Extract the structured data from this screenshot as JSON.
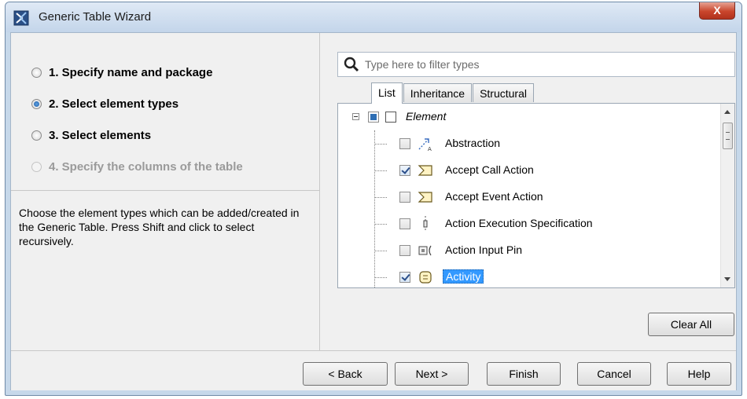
{
  "window": {
    "title": "Generic Table Wizard",
    "close_label": "X"
  },
  "steps": [
    {
      "label": "1. Specify name and package",
      "state": "unchecked"
    },
    {
      "label": "2. Select element types",
      "state": "checked"
    },
    {
      "label": "3. Select elements",
      "state": "unchecked"
    },
    {
      "label": "4. Specify the columns of the table",
      "state": "disabled"
    }
  ],
  "description": "Choose the element types which can be added/created in the Generic Table. Press Shift and click to select recursively.",
  "filter": {
    "placeholder": "Type here to filter types",
    "value": "",
    "icon": "search-icon"
  },
  "tabs": [
    {
      "label": "List",
      "active": true
    },
    {
      "label": "Inheritance",
      "active": false
    },
    {
      "label": "Structural",
      "active": false
    }
  ],
  "tree": {
    "root": {
      "label": "Element",
      "expanded": true
    },
    "items": [
      {
        "label": "Abstraction",
        "checked": false,
        "icon": "abstraction-icon",
        "selected": false
      },
      {
        "label": "Accept Call Action",
        "checked": true,
        "icon": "accept-call-action-icon",
        "selected": false
      },
      {
        "label": "Accept Event Action",
        "checked": false,
        "icon": "accept-event-action-icon",
        "selected": false
      },
      {
        "label": "Action Execution Specification",
        "checked": false,
        "icon": "action-execution-specification-icon",
        "selected": false
      },
      {
        "label": "Action Input Pin",
        "checked": false,
        "icon": "action-input-pin-icon",
        "selected": false
      },
      {
        "label": "Activity",
        "checked": true,
        "icon": "activity-icon",
        "selected": true
      }
    ]
  },
  "buttons": {
    "clear_all": "Clear All",
    "back": "< Back",
    "next": "Next >",
    "finish": "Finish",
    "cancel": "Cancel",
    "help": "Help"
  },
  "colors": {
    "selection": "#3399ff",
    "window_frame": "#c6d8ea",
    "close_button": "#c9452c"
  }
}
